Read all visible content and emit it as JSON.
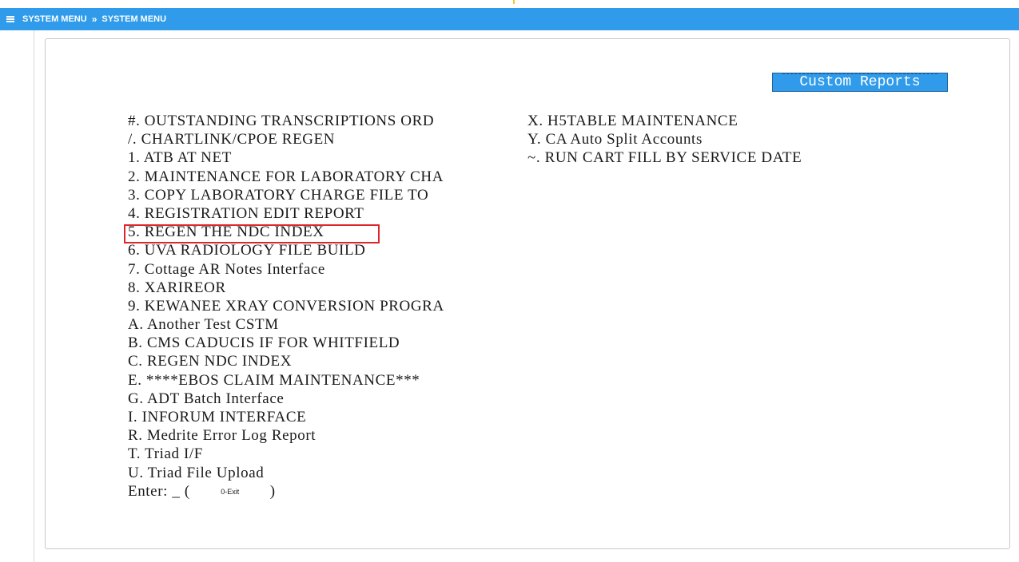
{
  "topbar": {
    "menu_icon": "hamburger-icon",
    "breadcrumb_1": "SYSTEM MENU",
    "separator": "»",
    "breadcrumb_2": "SYSTEM MENU",
    "background_color": "#2f9bea"
  },
  "report_title": "Custom Reports",
  "column1_items": [
    "#. OUTSTANDING TRANSCRIPTIONS ORD",
    "/. CHARTLINK/CPOE REGEN",
    "1. ATB AT NET",
    "2. MAINTENANCE FOR LABORATORY CHA",
    "3. COPY LABORATORY CHARGE FILE TO",
    "4. REGISTRATION EDIT REPORT",
    "5. REGEN THE NDC INDEX",
    "6. UVA RADIOLOGY FILE BUILD",
    "7. Cottage AR Notes Interface",
    "8. XARIREOR",
    "9. KEWANEE XRAY CONVERSION PROGRA",
    "A. Another Test CSTM",
    "B. CMS CADUCIS IF FOR WHITFIELD",
    "C. REGEN NDC INDEX",
    "E. ****EBOS CLAIM MAINTENANCE***",
    "G. ADT Batch Interface",
    "I. INFORUM INTERFACE",
    "R. Medrite Error Log Report",
    "T. Triad I/F",
    "U. Triad File Upload"
  ],
  "column2_items": [
    "X. H5TABLE MAINTENANCE",
    "Y. CA Auto Split Accounts",
    "~. RUN CART FILL BY SERVICE DATE"
  ],
  "prompt": {
    "label": "Enter: _ (",
    "exit_hint": "0-Exit",
    "close": ")"
  },
  "highlighted_item": "5. REGEN THE NDC INDEX",
  "highlight_color": "#e0242a"
}
